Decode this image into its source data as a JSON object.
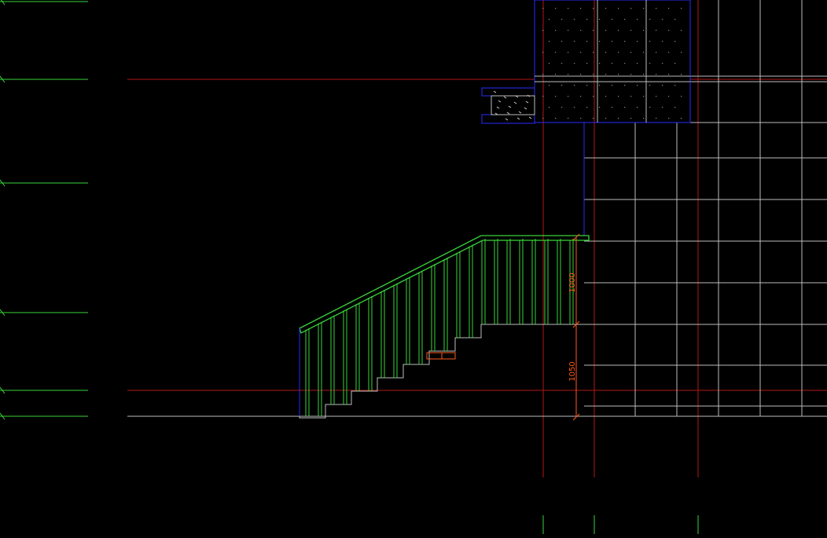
{
  "drawing": {
    "background": "#000000",
    "colors": {
      "green": "#39d43a",
      "red": "#b01818",
      "blue": "#2a2aff",
      "grey": "#bdbdbd",
      "orange": "#ff5a1a"
    },
    "dimensions": [
      {
        "label": "1000"
      },
      {
        "label": "1050"
      }
    ],
    "level_marks": 6,
    "treads": 7,
    "balusters": 23
  }
}
